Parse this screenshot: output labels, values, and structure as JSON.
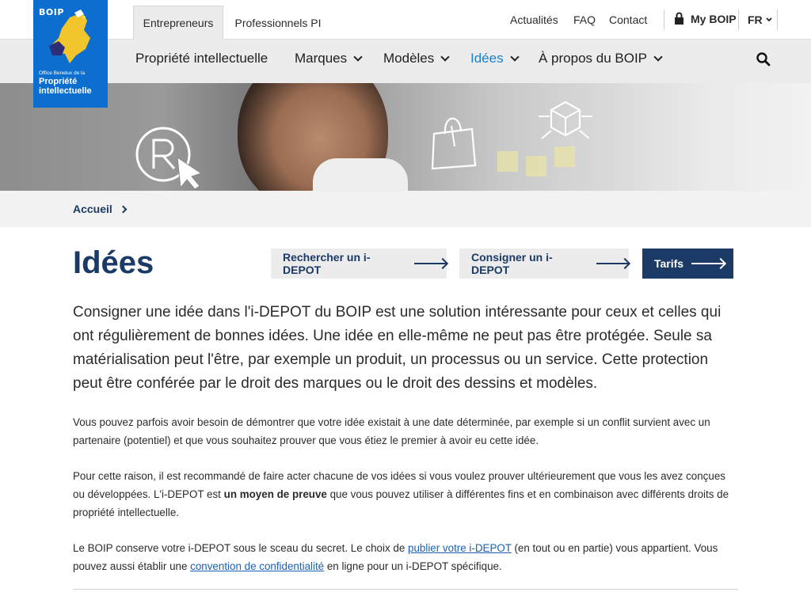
{
  "logo": {
    "abbr": "BOIP",
    "office_line": "Office Benelux de la",
    "name_line1": "Propriété",
    "name_line2": "intellectuelle"
  },
  "topbar": {
    "tabs": [
      {
        "label": "Entrepreneurs",
        "active": true
      },
      {
        "label": "Professionnels PI",
        "active": false
      }
    ],
    "links": [
      "Actualités",
      "FAQ",
      "Contact"
    ],
    "my_boip": "My BOIP",
    "language": "FR"
  },
  "mainnav": {
    "items": [
      {
        "label": "Propriété intellectuelle",
        "dropdown": false,
        "active": false
      },
      {
        "label": "Marques",
        "dropdown": true,
        "active": false
      },
      {
        "label": "Modèles",
        "dropdown": true,
        "active": false
      },
      {
        "label": "Idées",
        "dropdown": true,
        "active": true
      },
      {
        "label": "À propos du BOIP",
        "dropdown": true,
        "active": false
      }
    ],
    "search_icon": "search-icon"
  },
  "breadcrumb": {
    "items": [
      "Accueil"
    ]
  },
  "page": {
    "title": "Idées",
    "buttons": [
      {
        "label": "Rechercher un i-DEPOT",
        "style": "light"
      },
      {
        "label": "Consigner un i-DEPOT",
        "style": "light"
      },
      {
        "label": "Tarifs",
        "style": "dark"
      }
    ],
    "lead": "Consigner une idée dans l'i-DEPOT du BOIP est une solution intéressante pour ceux et celles qui ont régulièrement de bonnes idées. Une idée en elle-même ne peut pas être protégée. Seule sa matérialisation peut l'être, par exemple un produit, un processus ou un service. Cette protection peut être conférée par le droit des marques ou le droit des dessins et modèles.",
    "para1": "Vous pouvez parfois avoir besoin de démontrer que votre idée existait à une date déterminée, par exemple si un conflit survient avec un partenaire (potentiel) et que vous souhaitez prouver que vous étiez le premier à avoir eu cette idée.",
    "para2_before": "Pour cette raison, il est recommandé de faire acter chacune de vos idées si vous voulez prouver ultérieurement que vous les avez conçues ou développées. L'i-DEPOT est ",
    "para2_bold": "un moyen de preuve",
    "para2_after": " que vous pouvez utiliser à différentes fins et en combinaison avec différents droits de propriété intellectuelle.",
    "para3_before": "Le BOIP conserve votre i-DEPOT sous le sceau du secret. Le choix de ",
    "para3_link1": "publier votre i-DEPOT",
    "para3_middle": " (en tout ou en partie) vous appartient. Vous pouvez aussi établir une ",
    "para3_link2": "convention de confidentialité",
    "para3_after": " en ligne pour un i-DEPOT spécifique."
  },
  "colors": {
    "brand_blue": "#0c6fcf",
    "navy": "#1b3a66",
    "active_nav": "#1b7fcf",
    "link": "#1b5fb4"
  }
}
